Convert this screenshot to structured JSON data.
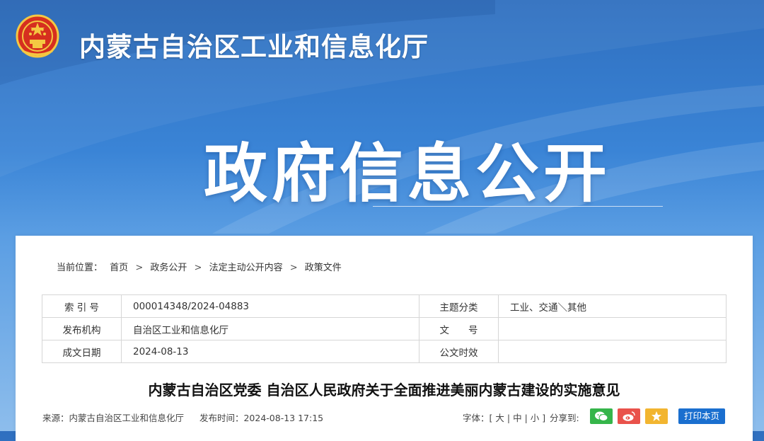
{
  "header": {
    "site_title": "内蒙古自治区工业和信息化厅",
    "banner_title": "政府信息公开"
  },
  "breadcrumb": {
    "label": "当前位置：",
    "items": [
      "首页",
      "政务公开",
      "法定主动公开内容",
      "政策文件"
    ],
    "separator": ">"
  },
  "meta_table": {
    "index_label": "索 引 号",
    "index_value": "000014348/2024-04883",
    "topic_label": "主题分类",
    "topic_value": "工业、交通＼其他",
    "publisher_label": "发布机构",
    "publisher_value": "自治区工业和信息化厅",
    "doc_no_label": "文　　号",
    "doc_no_value": "",
    "date_label": "成文日期",
    "date_value": "2024-08-13",
    "validity_label": "公文时效",
    "validity_value": ""
  },
  "document": {
    "title": "内蒙古自治区党委 自治区人民政府关于全面推进美丽内蒙古建设的实施意见",
    "source": "来源：内蒙古自治区工业和信息化厅",
    "published": "发布时间：2024-08-13 17:15"
  },
  "toolbar": {
    "font_label": "字体：[",
    "font_large": "大",
    "font_medium": "中",
    "font_small": "小",
    "font_close": "]",
    "share_label": "分享到:",
    "print_label": "打印本页"
  },
  "colors": {
    "brand_blue": "#1a6fcf",
    "wechat_green": "#35b54a",
    "weibo_red": "#e9524b",
    "favorite_yellow": "#f2b530"
  }
}
